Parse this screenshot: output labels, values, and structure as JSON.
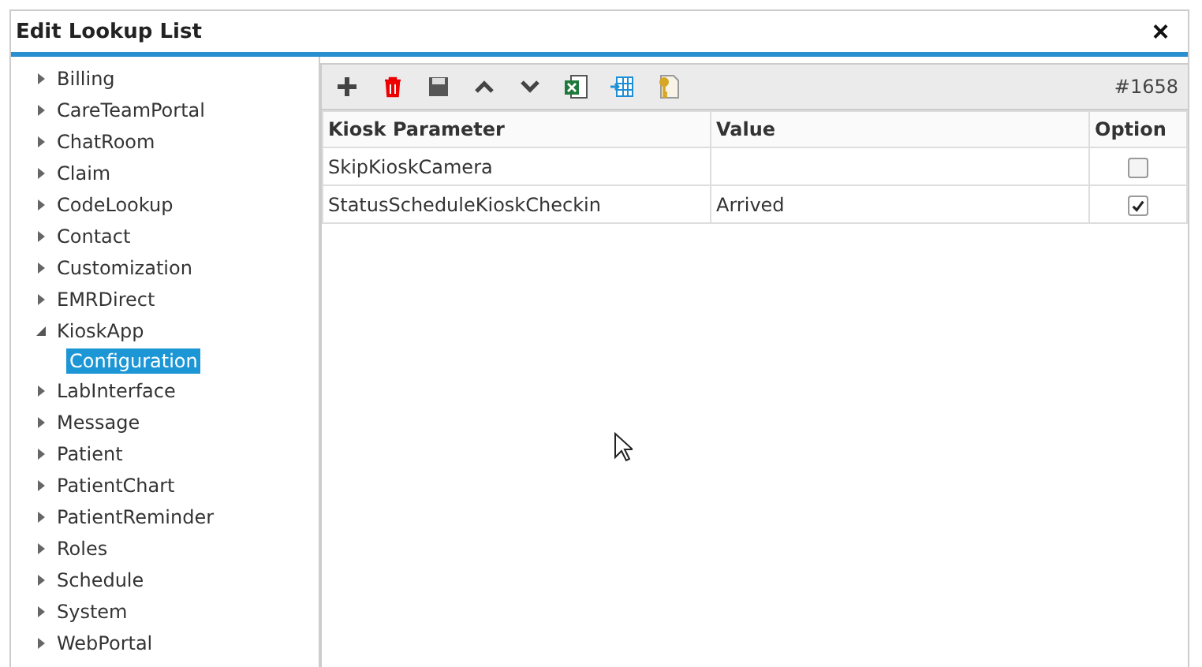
{
  "window": {
    "title": "Edit Lookup List",
    "close": "×"
  },
  "tree": [
    {
      "label": "Billing",
      "expanded": false,
      "selected": false
    },
    {
      "label": "CareTeamPortal",
      "expanded": false,
      "selected": false
    },
    {
      "label": "ChatRoom",
      "expanded": false,
      "selected": false
    },
    {
      "label": "Claim",
      "expanded": false,
      "selected": false
    },
    {
      "label": "CodeLookup",
      "expanded": false,
      "selected": false
    },
    {
      "label": "Contact",
      "expanded": false,
      "selected": false
    },
    {
      "label": "Customization",
      "expanded": false,
      "selected": false
    },
    {
      "label": "EMRDirect",
      "expanded": false,
      "selected": false
    },
    {
      "label": "KioskApp",
      "expanded": true,
      "selected": false,
      "children": [
        {
          "label": "Configuration",
          "selected": true
        }
      ]
    },
    {
      "label": "LabInterface",
      "expanded": false,
      "selected": false
    },
    {
      "label": "Message",
      "expanded": false,
      "selected": false
    },
    {
      "label": "Patient",
      "expanded": false,
      "selected": false
    },
    {
      "label": "PatientChart",
      "expanded": false,
      "selected": false
    },
    {
      "label": "PatientReminder",
      "expanded": false,
      "selected": false
    },
    {
      "label": "Roles",
      "expanded": false,
      "selected": false
    },
    {
      "label": "Schedule",
      "expanded": false,
      "selected": false
    },
    {
      "label": "System",
      "expanded": false,
      "selected": false
    },
    {
      "label": "WebPortal",
      "expanded": false,
      "selected": false
    }
  ],
  "toolbar": {
    "record_id": "#1658"
  },
  "table": {
    "columns": [
      "Kiosk Parameter",
      "Value",
      "Option"
    ],
    "rows": [
      {
        "parameter": "SkipKioskCamera",
        "checked": false
      },
      {
        "parameter": "StatusScheduleKioskCheckin",
        "value": "Arrived",
        "checked": true
      }
    ]
  }
}
